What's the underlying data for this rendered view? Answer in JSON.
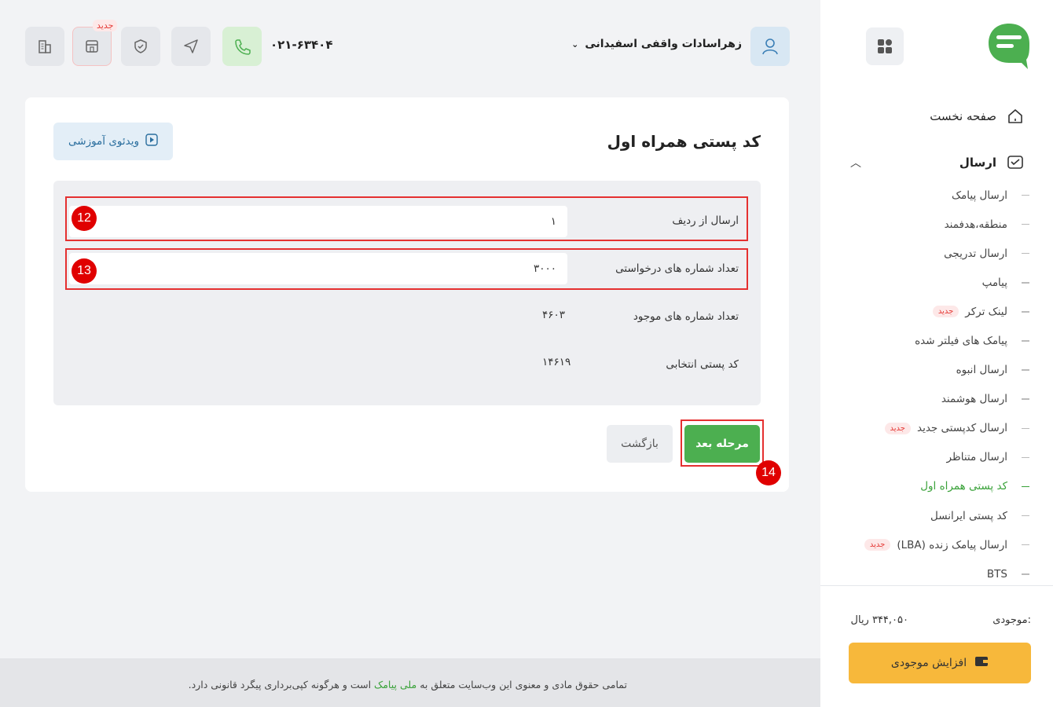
{
  "header": {
    "user_name": "زهراسادات واقفی اسفیدانی",
    "phone": "۰۲۱-۶۳۴۰۴",
    "new_tag": "جدید",
    "icons": [
      "phone-icon",
      "send-icon",
      "shield-icon",
      "store-icon",
      "building-icon"
    ]
  },
  "sidebar": {
    "home": "صفحه نخست",
    "send": "ارسال",
    "items": [
      {
        "label": "ارسال پیامک",
        "badge": ""
      },
      {
        "label": "منطقه،هدفمند",
        "badge": ""
      },
      {
        "label": "ارسال تدریجی",
        "badge": ""
      },
      {
        "label": "پیامپ",
        "badge": ""
      },
      {
        "label": "لینک ترکر",
        "badge": "جدید"
      },
      {
        "label": "پیامک های فیلتر شده",
        "badge": ""
      },
      {
        "label": "ارسال انبوه",
        "badge": ""
      },
      {
        "label": "ارسال هوشمند",
        "badge": ""
      },
      {
        "label": "ارسال کدپستی جدید",
        "badge": "جدید"
      },
      {
        "label": "ارسال متناظر",
        "badge": ""
      },
      {
        "label": "کد پستی همراه اول",
        "badge": "",
        "active": true
      },
      {
        "label": "کد پستی ایرانسل",
        "badge": ""
      },
      {
        "label": "ارسال پیامک زنده (LBA)",
        "badge": "جدید"
      },
      {
        "label": "BTS",
        "badge": ""
      }
    ],
    "balance_label": "موجودی:",
    "balance_value": "۳۴۴,۰۵۰ ریال",
    "topup_label": "افزایش موجودی"
  },
  "main": {
    "title": "کد پستی همراه اول",
    "video_label": "ویدئوی آموزشی",
    "rows": [
      {
        "label": "ارسال از ردیف",
        "value": "۱"
      },
      {
        "label": "تعداد شماره های درخواستی",
        "value": "۳۰۰۰"
      },
      {
        "label": "تعداد شماره های موجود",
        "value": "۴۶۰۳"
      },
      {
        "label": "کد پستی انتخابی",
        "value": "۱۴۶۱۹"
      }
    ],
    "next_label": "مرحله بعد",
    "back_label": "بازگشت",
    "annotations": [
      "12",
      "13",
      "14"
    ]
  },
  "footer": {
    "text_before": "تمامی حقوق مادی و معنوی این وب‌سایت متعلق به",
    "brand": "ملی پیامک",
    "text_after": "است و هرگونه کپی‌برداری پیگرد قانونی دارد."
  },
  "colors": {
    "accent_green": "#4caf50",
    "topup_yellow": "#f7b83b",
    "annotation_red": "#e53030"
  }
}
